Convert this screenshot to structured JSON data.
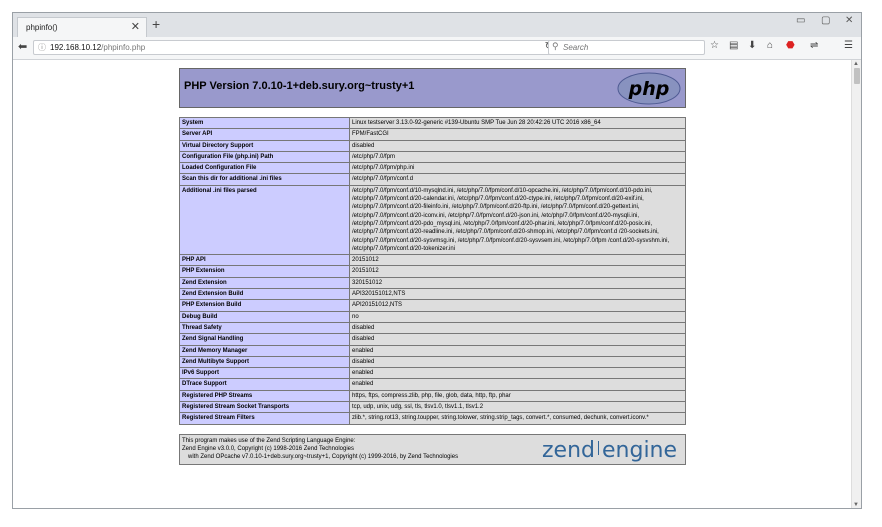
{
  "tab": {
    "title": "phpinfo()"
  },
  "navbar": {
    "url_host": "192.168.10.12",
    "url_path": "/phpinfo.php",
    "search_placeholder": "Search"
  },
  "page": {
    "title": "PHP Version 7.0.10-1+deb.sury.org~trusty+1",
    "logo_text": "php",
    "rows": [
      {
        "key": "System",
        "value": "Linux testserver 3.13.0-92-generic #139-Ubuntu SMP Tue Jun 28 20:42:26 UTC 2016 x86_64"
      },
      {
        "key": "Server API",
        "value": "FPM/FastCGI"
      },
      {
        "key": "Virtual Directory Support",
        "value": "disabled"
      },
      {
        "key": "Configuration File (php.ini) Path",
        "value": "/etc/php/7.0/fpm"
      },
      {
        "key": "Loaded Configuration File",
        "value": "/etc/php/7.0/fpm/php.ini"
      },
      {
        "key": "Scan this dir for additional .ini files",
        "value": "/etc/php/7.0/fpm/conf.d"
      },
      {
        "key": "Additional .ini files parsed",
        "value": "/etc/php/7.0/fpm/conf.d/10-mysqlnd.ini, /etc/php/7.0/fpm/conf.d/10-opcache.ini, /etc/php/7.0/fpm/conf.d/10-pdo.ini, /etc/php/7.0/fpm/conf.d/20-calendar.ini, /etc/php/7.0/fpm/conf.d/20-ctype.ini, /etc/php/7.0/fpm/conf.d/20-exif.ini, /etc/php/7.0/fpm/conf.d/20-fileinfo.ini, /etc/php/7.0/fpm/conf.d/20-ftp.ini, /etc/php/7.0/fpm/conf.d/20-gettext.ini, /etc/php/7.0/fpm/conf.d/20-iconv.ini, /etc/php/7.0/fpm/conf.d/20-json.ini, /etc/php/7.0/fpm/conf.d/20-mysqli.ini, /etc/php/7.0/fpm/conf.d/20-pdo_mysql.ini, /etc/php/7.0/fpm/conf.d/20-phar.ini, /etc/php/7.0/fpm/conf.d/20-posix.ini, /etc/php/7.0/fpm/conf.d/20-readline.ini, /etc/php/7.0/fpm/conf.d/20-shmop.ini, /etc/php/7.0/fpm/conf.d /20-sockets.ini, /etc/php/7.0/fpm/conf.d/20-sysvmsg.ini, /etc/php/7.0/fpm/conf.d/20-sysvsem.ini, /etc/php/7.0/fpm /conf.d/20-sysvshm.ini, /etc/php/7.0/fpm/conf.d/20-tokenizer.ini"
      },
      {
        "key": "PHP API",
        "value": "20151012"
      },
      {
        "key": "PHP Extension",
        "value": "20151012"
      },
      {
        "key": "Zend Extension",
        "value": "320151012"
      },
      {
        "key": "Zend Extension Build",
        "value": "API320151012,NTS"
      },
      {
        "key": "PHP Extension Build",
        "value": "API20151012,NTS"
      },
      {
        "key": "Debug Build",
        "value": "no"
      },
      {
        "key": "Thread Safety",
        "value": "disabled"
      },
      {
        "key": "Zend Signal Handling",
        "value": "disabled"
      },
      {
        "key": "Zend Memory Manager",
        "value": "enabled"
      },
      {
        "key": "Zend Multibyte Support",
        "value": "disabled"
      },
      {
        "key": "IPv6 Support",
        "value": "enabled"
      },
      {
        "key": "DTrace Support",
        "value": "enabled"
      },
      {
        "key": "Registered PHP Streams",
        "value": "https, ftps, compress.zlib, php, file, glob, data, http, ftp, phar"
      },
      {
        "key": "Registered Stream Socket Transports",
        "value": "tcp, udp, unix, udg, ssl, tls, tlsv1.0, tlsv1.1, tlsv1.2"
      },
      {
        "key": "Registered Stream Filters",
        "value": "zlib.*, string.rot13, string.toupper, string.tolower, string.strip_tags, convert.*, consumed, dechunk, convert.iconv.*"
      }
    ],
    "footer": {
      "line1": "This program makes use of the Zend Scripting Language Engine:",
      "line2": "Zend Engine v3.0.0, Copyright (c) 1998-2016 Zend Technologies",
      "line3": "with Zend OPcache v7.0.10-1+deb.sury.org~trusty+1, Copyright (c) 1999-2016, by Zend Technologies",
      "logo_text_1": "zend",
      "logo_text_2": "engine"
    }
  },
  "colors": {
    "header_bg": "#9999cc",
    "key_bg": "#ccccff",
    "value_bg": "#dddddd",
    "zend_blue": "#336699"
  },
  "icons": [
    "close-icon",
    "new-tab-icon",
    "minimize-icon",
    "maximize-icon",
    "window-close-icon",
    "back-icon",
    "info-icon",
    "reload-icon",
    "search-icon",
    "bookmark-star-icon",
    "reading-list-icon",
    "download-icon",
    "home-icon",
    "adblock-icon",
    "extension-icon",
    "menu-icon"
  ]
}
